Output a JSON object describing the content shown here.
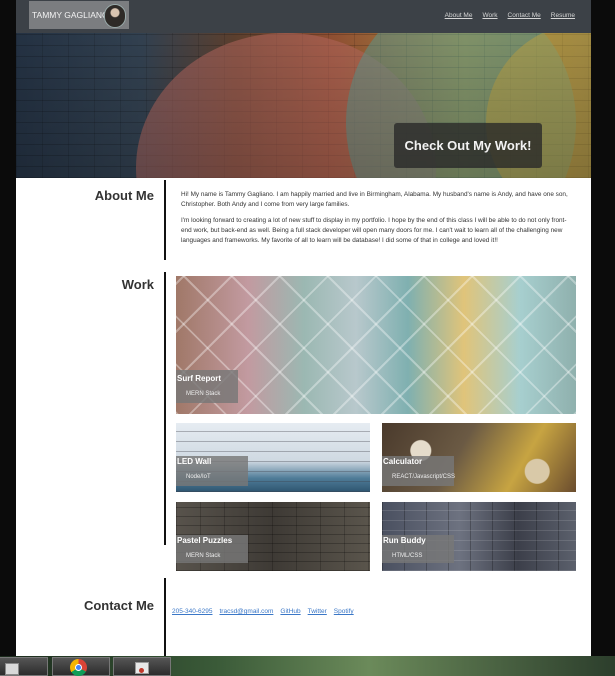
{
  "brand": {
    "name": "TAMMY GAGLIANO"
  },
  "nav": {
    "links": [
      "About Me",
      "Work",
      "Contact Me",
      "Resume"
    ]
  },
  "hero": {
    "cta_label": "Check Out My Work!"
  },
  "about": {
    "title": "About Me",
    "paragraphs": [
      "Hi! My name is Tammy Gagliano. I am happily married and live in Birmingham, Alabama. My husband's name is Andy, and have one son, Christopher. Both Andy and I come from very large families.",
      "I'm looking forward to creating a lot of new stuff to display in my portfolio. I hope by the end of this class I will be able to do not only front-end work, but back-end as well. Being a full stack developer will open many doors for me. I can't wait to learn all of the challenging new languages and frameworks. My favorite of all to learn will be database! I did some of that in college and loved it!!"
    ]
  },
  "work": {
    "title": "Work",
    "projects": [
      {
        "title": "Surf Report",
        "stack": "MERN Stack"
      },
      {
        "title": "LED Wall",
        "stack": "Node/IoT"
      },
      {
        "title": "Calculator",
        "stack": "REACT/Javascript/CSS"
      },
      {
        "title": "Pastel Puzzles",
        "stack": "MERN Stack"
      },
      {
        "title": "Run Buddy",
        "stack": "HTML/CSS"
      }
    ]
  },
  "contact": {
    "title": "Contact Me",
    "links": [
      "205-340-6295",
      "tracsd@gmail.com",
      "GitHub",
      "Twitter",
      "Spotify"
    ]
  },
  "taskbar": {
    "icons": [
      "file-explorer-icon",
      "chrome-icon",
      "snipping-tool-icon"
    ]
  }
}
